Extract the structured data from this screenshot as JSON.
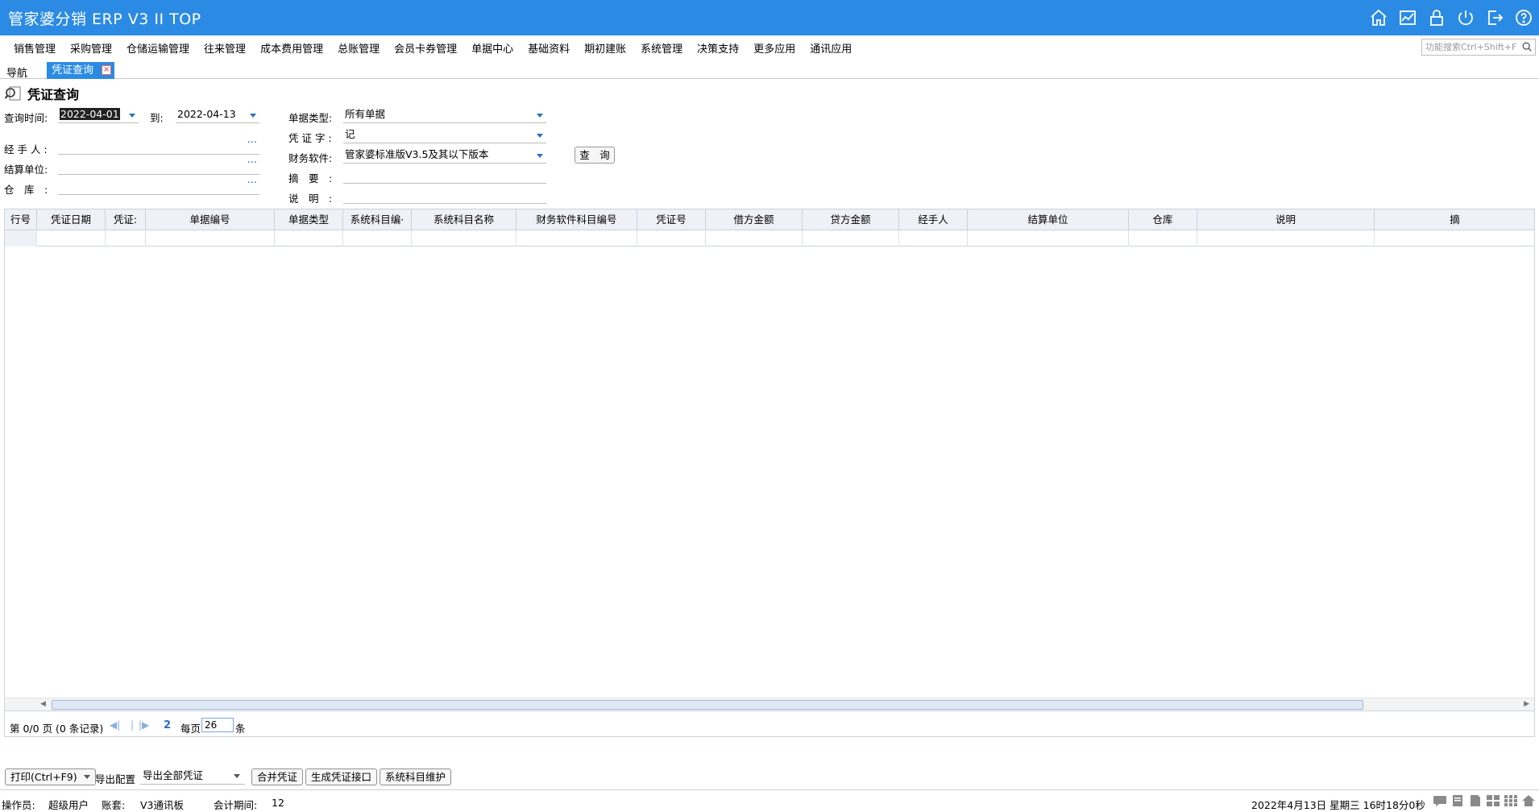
{
  "app": {
    "title": "管家婆分销 ERP V3 II TOP"
  },
  "menu": {
    "items": [
      "销售管理",
      "采购管理",
      "仓储运输管理",
      "往来管理",
      "成本费用管理",
      "总账管理",
      "会员卡券管理",
      "单据中心",
      "基础资料",
      "期初建账",
      "系统管理",
      "决策支持",
      "更多应用",
      "通讯应用"
    ],
    "search_placeholder": "功能搜索Ctrl+Shift+F"
  },
  "tabs": {
    "nav": "导航",
    "active": "凭证查询",
    "close": "×"
  },
  "page": {
    "title": "凭证查询"
  },
  "form": {
    "query_time_label": "查询时间:",
    "date_from": "2022-04-01",
    "to_label": "到:",
    "date_to": "2022-04-13",
    "bill_type_label": "单据类型:",
    "bill_type_value": "所有单据",
    "voucher_word_label": "凭 证 字 :",
    "voucher_word_value": "记",
    "handler_label": "经 手 人 :",
    "finance_software_label": "财务软件:",
    "finance_software_value": "管家婆标准版V3.5及其以下版本",
    "settlement_label": "结算单位:",
    "summary_label": "摘　要　:",
    "warehouse_label": "仓　库　:",
    "note_label": "说　明　:",
    "query_button": "查　询",
    "dots": "···"
  },
  "grid": {
    "columns": [
      "行号",
      "凭证日期",
      "凭证:",
      "单据编号",
      "单据类型",
      "系统科目编·",
      "系统科目名称",
      "财务软件科目编号",
      "凭证号",
      "借方金额",
      "贷方金额",
      "经手人",
      "结算单位",
      "仓库",
      "说明",
      "摘"
    ]
  },
  "pager": {
    "page_text": "第  0/0 页  (0 条记录)",
    "per_page_label": "每页",
    "per_page_value": "26",
    "unit": "条",
    "refresh": "2"
  },
  "actions": {
    "print": "打印(Ctrl+F9)",
    "export_label": "导出配置",
    "export_value": "导出全部凭证",
    "merge": "合并凭证",
    "generate": "生成凭证接口",
    "maintain": "系统科目维护"
  },
  "status": {
    "operator_label": "操作员:",
    "operator": "超级用户",
    "account_label": "账套:",
    "account": "V3通讯板",
    "period_label": "会计期间:",
    "period": "12",
    "datetime": "2022年4月13日  星期三  16时18分0秒"
  },
  "icons": {
    "top": [
      "home-icon",
      "chart-icon",
      "lock-icon",
      "power-icon",
      "exit-icon",
      "help-icon"
    ],
    "status": [
      "chat-icon",
      "note-icon",
      "document-icon",
      "grid-icon",
      "apps-icon",
      "home-icon"
    ]
  },
  "colors": {
    "accent": "#2b8be4",
    "link": "#2b6fc9"
  }
}
